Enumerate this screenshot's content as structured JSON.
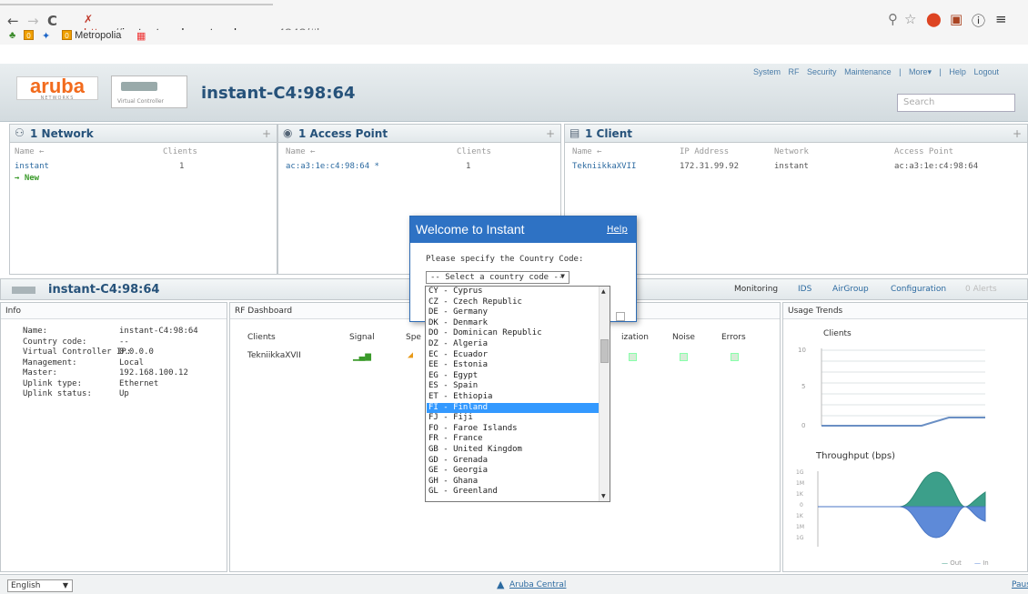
{
  "browser": {
    "url_scheme": "https",
    "url_sep": "://",
    "url_host": "instant.arubanetworks.com",
    "url_rest": ":4343/#home",
    "bookmarks": [
      "0",
      "Metropolia"
    ]
  },
  "header": {
    "logo": "aruba",
    "logo_sub": "NETWORKS",
    "vc_label": "Virtual Controller",
    "device_name": "instant-C4:98:64",
    "nav": [
      "System",
      "RF",
      "Security",
      "Maintenance",
      "|",
      "More▾",
      "|",
      "Help",
      "Logout"
    ],
    "search_placeholder": "Search"
  },
  "networks": {
    "title": "1 Network",
    "cols": [
      "Name ←",
      "Clients"
    ],
    "rows": [
      {
        "name": "instant",
        "clients": "1"
      }
    ],
    "new_label": "→ New"
  },
  "access_points": {
    "title": "1 Access Point",
    "cols": [
      "Name ←",
      "Clients"
    ],
    "rows": [
      {
        "name": "ac:a3:1e:c4:98:64 *",
        "clients": "1"
      }
    ]
  },
  "clients": {
    "title": "1 Client",
    "cols": [
      "Name ←",
      "IP Address",
      "Network",
      "Access Point"
    ],
    "rows": [
      {
        "name": "TekniikkaXVII",
        "ip": "172.31.99.92",
        "network": "instant",
        "ap": "ac:a3:1e:c4:98:64"
      }
    ]
  },
  "section": {
    "title": "instant-C4:98:64",
    "tabs": [
      "Monitoring",
      "IDS",
      "AirGroup",
      "Configuration",
      "0 Alerts"
    ]
  },
  "info": {
    "title": "Info",
    "fields": [
      {
        "k": "Name:",
        "v": "instant-C4:98:64"
      },
      {
        "k": "Country code:",
        "v": "--"
      },
      {
        "k": "Virtual Controller IP:",
        "v": "0.0.0.0"
      },
      {
        "k": "Management:",
        "v": "Local"
      },
      {
        "k": "Master:",
        "v": "192.168.100.12"
      },
      {
        "k": "Uplink type:",
        "v": "Ethernet"
      },
      {
        "k": "Uplink status:",
        "v": "Up"
      }
    ]
  },
  "rf": {
    "title": "RF Dashboard",
    "cols": [
      "Clients",
      "Signal",
      "Spe",
      "ization",
      "Noise",
      "Errors"
    ],
    "client": "TekniikkaXVII"
  },
  "usage": {
    "title": "Usage Trends",
    "clients_title": "Clients",
    "clients_ticks": [
      "10",
      "5",
      "0"
    ],
    "throughput_title": "Throughput  (bps)",
    "throughput_ticks": [
      "1G",
      "1M",
      "1K",
      "0",
      "1K",
      "1M",
      "1G"
    ],
    "legend_out": "Out",
    "legend_in": "In"
  },
  "modal": {
    "title": "Welcome to Instant",
    "help": "Help",
    "prompt": "Please specify the Country Code:",
    "select_placeholder": "-- Select a country code --",
    "options": [
      "CY - Cyprus",
      "CZ - Czech Republic",
      "DE - Germany",
      "DK - Denmark",
      "DO - Dominican Republic",
      "DZ - Algeria",
      "EC - Ecuador",
      "EE - Estonia",
      "EG - Egypt",
      "ES - Spain",
      "ET - Ethiopia",
      "FI - Finland",
      "FJ - Fiji",
      "FO - Faroe Islands",
      "FR - France",
      "GB - United Kingdom",
      "GD - Grenada",
      "GE - Georgia",
      "GH - Ghana",
      "GL - Greenland"
    ],
    "selected_index": 11
  },
  "footer": {
    "language": "English",
    "central": "Aruba Central",
    "pause": "Paus"
  }
}
